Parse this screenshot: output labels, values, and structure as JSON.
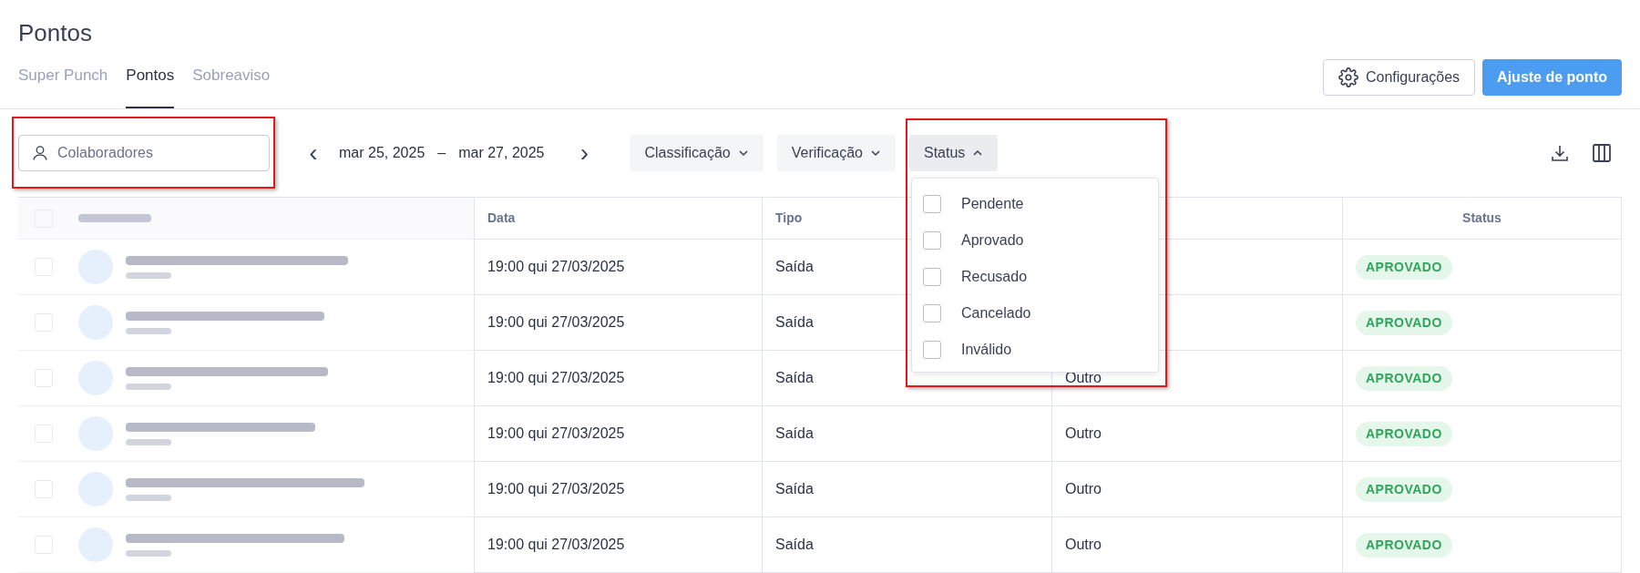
{
  "page": {
    "title": "Pontos"
  },
  "tabs": [
    {
      "label": "Super Punch",
      "selected": false
    },
    {
      "label": "Pontos",
      "selected": true
    },
    {
      "label": "Sobreaviso",
      "selected": false
    }
  ],
  "actions": {
    "settings": "Configurações",
    "primary": "Ajuste de ponto"
  },
  "filters": {
    "people": {
      "placeholder": "Colaboradores"
    },
    "date_range": {
      "start": "mar 25, 2025",
      "separator": "–",
      "end": "mar 27, 2025",
      "prev": "‹",
      "next": "›"
    },
    "dropdowns": [
      {
        "label": "Classificação",
        "expanded": false
      },
      {
        "label": "Verificação",
        "expanded": false
      },
      {
        "label": "Status",
        "expanded": true
      }
    ]
  },
  "status_menu": [
    {
      "label": "Pendente",
      "checked": false
    },
    {
      "label": "Aprovado",
      "checked": false
    },
    {
      "label": "Recusado",
      "checked": false
    },
    {
      "label": "Cancelado",
      "checked": false
    },
    {
      "label": "Inválido",
      "checked": false
    }
  ],
  "table": {
    "all_selected": false,
    "columns": {
      "data": "Data",
      "tipo": "Tipo",
      "status": "Status"
    },
    "rows": [
      {
        "selected": false,
        "data": "19:00 qui 27/03/2025",
        "tipo": "Saída",
        "status": "APROVADO"
      },
      {
        "selected": false,
        "data": "19:00 qui 27/03/2025",
        "tipo": "Saída",
        "status": "APROVADO"
      },
      {
        "selected": false,
        "data": "19:00 qui 27/03/2025",
        "tipo": "Saída",
        "column_4": "Outro",
        "status": "APROVADO"
      },
      {
        "selected": false,
        "data": "19:00 qui 27/03/2025",
        "tipo": "Saída",
        "column_4": "Outro",
        "status": "APROVADO"
      },
      {
        "selected": false,
        "data": "19:00 qui 27/03/2025",
        "tipo": "Saída",
        "column_4": "Outro",
        "status": "APROVADO"
      },
      {
        "selected": false,
        "data": "19:00 qui 27/03/2025",
        "tipo": "Saída",
        "column_4": "Outro",
        "status": "APROVADO"
      }
    ]
  }
}
